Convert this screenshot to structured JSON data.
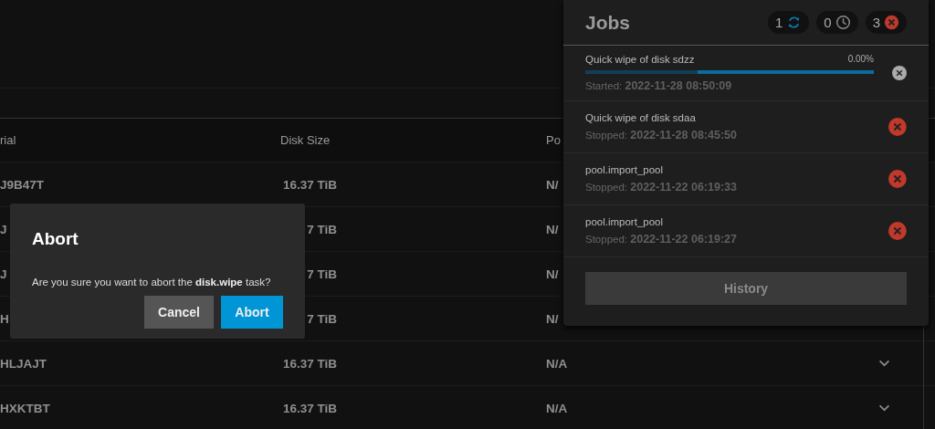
{
  "table": {
    "columns": [
      "rial",
      "Disk Size",
      "Po"
    ],
    "rows": [
      {
        "cells": [
          "J9B47T",
          "16.37 TiB",
          "N/"
        ]
      },
      {
        "cells": [
          "J",
          "7 TiB",
          "N/"
        ]
      },
      {
        "cells": [
          "J",
          "7 TiB",
          "N/"
        ]
      },
      {
        "cells": [
          "H",
          "7 TiB",
          "N/"
        ]
      },
      {
        "cells": [
          "HLJAJT",
          "16.37 TiB",
          "N/A"
        ],
        "expandable": true
      },
      {
        "cells": [
          "HXKTBT",
          "16.37 TiB",
          "N/A"
        ],
        "expandable": true
      }
    ]
  },
  "dialog": {
    "title": "Abort",
    "message": "Are you sure you want to abort the **disk.wipe** task?",
    "buttons": [
      {
        "label": "Cancel",
        "kind": "secondary"
      },
      {
        "label": "Abort",
        "kind": "primary"
      }
    ]
  },
  "jobs_panel": {
    "title": "Jobs",
    "counters": [
      {
        "count": "1",
        "kind": "running"
      },
      {
        "count": "0",
        "kind": "waiting"
      },
      {
        "count": "3",
        "kind": "failed"
      }
    ],
    "jobs": [
      {
        "name": "Quick wipe of disk sdzz",
        "kind": "running",
        "percent": "0.00%",
        "level": 0.39,
        "status_label": "Started:",
        "time": "2022-11-28 08:50:09"
      },
      {
        "name": "Quick wipe of disk sdaa",
        "kind": "stopped",
        "status_label": "Stopped:",
        "time": "2022-11-28 08:45:50"
      },
      {
        "name": "pool.import_pool",
        "kind": "stopped",
        "status_label": "Stopped:",
        "time": "2022-11-22 06:19:33"
      },
      {
        "name": "pool.import_pool",
        "kind": "stopped",
        "status_label": "Stopped:",
        "time": "2022-11-22 06:19:27"
      }
    ],
    "history_button": "History"
  }
}
